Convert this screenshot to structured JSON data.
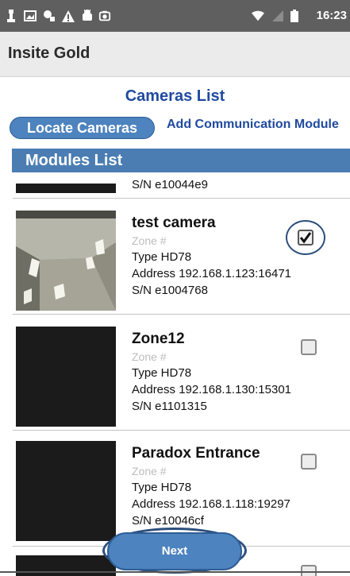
{
  "status_bar": {
    "time": "16:23",
    "left_icons": [
      "notification-icon",
      "gallery-icon",
      "usb-icon",
      "warning-icon",
      "android-icon",
      "photo-icon"
    ],
    "right_icons": [
      "wifi-icon",
      "signal-icon",
      "battery-icon"
    ]
  },
  "app_bar": {
    "title": "Insite Gold"
  },
  "cameras_title": "Cameras List",
  "locate_button": "Locate Cameras",
  "add_comm_link": "Add Communication Module",
  "modules_header": "Modules List",
  "partial_top_item": {
    "serial": "S/N e10044e9"
  },
  "modules": [
    {
      "name": "test camera",
      "zone": "Zone #",
      "type": "Type HD78",
      "address": "Address 192.168.1.123:16471",
      "serial": "S/N e1004768",
      "checked": true
    },
    {
      "name": "Zone12",
      "zone": "Zone #",
      "type": "Type HD78",
      "address": "Address 192.168.1.130:15301",
      "serial": "S/N e1101315",
      "checked": false
    },
    {
      "name": "Paradox Entrance",
      "zone": "Zone #",
      "type": "Type HD78",
      "address": "Address 192.168.1.118:19297",
      "serial": "S/N e10046cf",
      "checked": false
    }
  ],
  "next_button": "Next"
}
